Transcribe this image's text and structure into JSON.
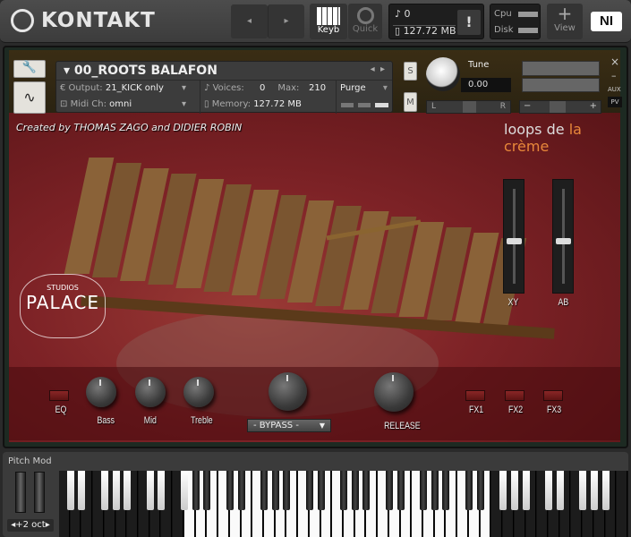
{
  "app": {
    "title": "KONTAKT"
  },
  "topbar": {
    "keyb_label": "Keyb",
    "quick_label": "Quick",
    "voices": "0",
    "memory": "127.72 MB",
    "warn": "!",
    "cpu_label": "Cpu",
    "disk_label": "Disk",
    "view_label": "View",
    "ni_logo": "NI"
  },
  "instrument": {
    "name": "00_ROOTS BALAFON",
    "output_label": "Output:",
    "output_value": "21_KICK only",
    "voices_label": "Voices:",
    "voices_value": "0",
    "max_label": "Max:",
    "max_value": "210",
    "purge_label": "Purge",
    "midi_label": "Midi Ch:",
    "midi_value": "omni",
    "memory_label": "Memory:",
    "memory_value": "127.72 MB",
    "solo": "S",
    "mute": "M",
    "tune_label": "Tune",
    "tune_value": "0.00",
    "pan_l": "L",
    "pan_r": "R",
    "vol_minus": "−",
    "vol_plus": "+",
    "close": "×",
    "minimize": "–",
    "aux": "AUX",
    "pv": "PV"
  },
  "panel": {
    "credit": "Created by THOMAS ZAGO and DIDIER ROBIN",
    "brand_a": "loops de ",
    "brand_b": "la crème",
    "brand_color": "#e8873a",
    "studio_top": "STUDIOS",
    "studio_name": "PALACE",
    "xy_label": "XY",
    "ab_label": "AB",
    "xy_level": 0.45,
    "ab_level": 0.45
  },
  "controls": {
    "eq": "EQ",
    "bass": "Bass",
    "mid": "Mid",
    "treble": "Treble",
    "bypass": "- BYPASS -",
    "release": "RELEASE",
    "fx1": "FX1",
    "fx2": "FX2",
    "fx3": "FX3"
  },
  "keyboard": {
    "pitch_mod": "Pitch Mod",
    "octave": "+2 oct"
  }
}
